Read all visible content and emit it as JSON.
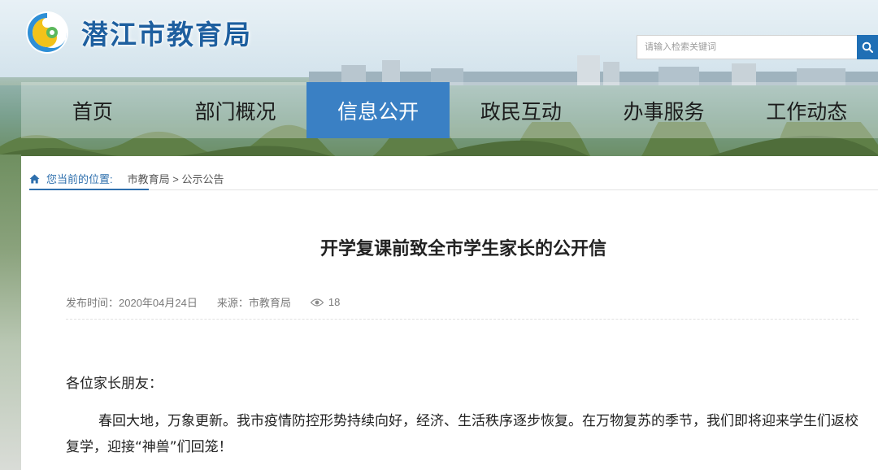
{
  "site": {
    "title": "潜江市教育局"
  },
  "search": {
    "placeholder": "请输入检索关键词"
  },
  "nav": {
    "items": [
      {
        "label": "首页"
      },
      {
        "label": "部门概况"
      },
      {
        "label": "信息公开"
      },
      {
        "label": "政民互动"
      },
      {
        "label": "办事服务"
      },
      {
        "label": "工作动态"
      }
    ],
    "active_index": 2
  },
  "breadcrumb": {
    "label": "您当前的位置:",
    "path": "市教育局 > 公示公告"
  },
  "article": {
    "title": "开学复课前致全市学生家长的公开信",
    "publish_time": "发布时间：2020年04月24日",
    "source": "来源：市教育局",
    "views": "18",
    "greeting": "各位家长朋友：",
    "paragraph": "春回大地，万象更新。我市疫情防控形势持续向好，经济、生活秩序逐步恢复。在万物复苏的季节，我们即将迎来学生们返校复学，迎接“神兽”们回笼！"
  },
  "icons": {
    "logo": "swirl-logo-icon",
    "search": "search-icon",
    "home": "home-icon",
    "views": "eye-icon"
  },
  "colors": {
    "brand_blue": "#1e5f9f",
    "nav_active": "#3a80c4",
    "search_button": "#1f6fb5"
  }
}
